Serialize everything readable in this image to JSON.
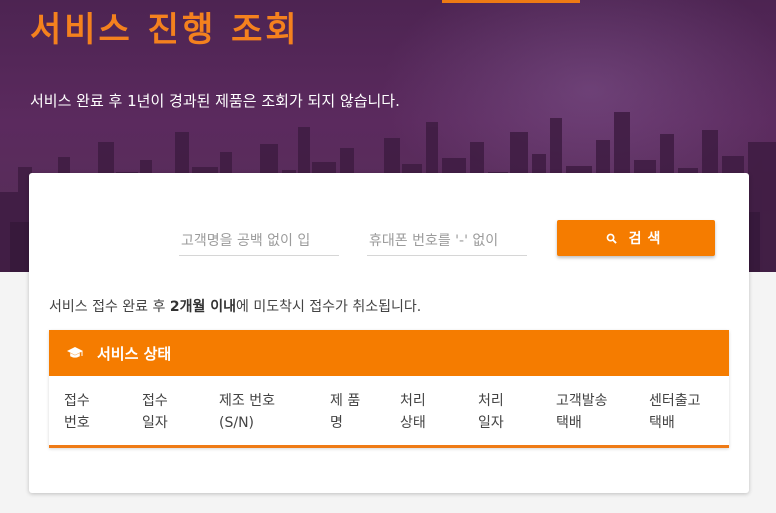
{
  "header": {
    "title": "서비스 진행 조회",
    "subtitle": "서비스 완료 후 1년이 경과된 제품은 조회가 되지 않습니다."
  },
  "search": {
    "name_placeholder": "고객명을 공백 없이 입",
    "name_value": "",
    "phone_placeholder": "휴대폰 번호를 '-' 없이",
    "phone_value": "",
    "button_label": "검색",
    "button_icon": "search-icon"
  },
  "notice": {
    "before": "서비스 접수 완료 후 ",
    "bold": "2개월 이내",
    "after": "에 미도착시 접수가 취소됩니다."
  },
  "status": {
    "title": "서비스 상태",
    "icon": "graduation-cap-icon",
    "columns": [
      {
        "line1": "접수",
        "line2": "번호"
      },
      {
        "line1": "접수",
        "line2": "일자"
      },
      {
        "line1": "제조 번호",
        "line2": "(S/N)"
      },
      {
        "line1": "제 품",
        "line2": "명"
      },
      {
        "line1": "처리",
        "line2": "상태"
      },
      {
        "line1": "처리",
        "line2": "일자"
      },
      {
        "line1": "고객발송",
        "line2": "택배"
      },
      {
        "line1": "센터출고",
        "line2": "택배"
      }
    ],
    "rows": []
  },
  "colors": {
    "accent": "#f57c00",
    "title_orange": "#f4811e",
    "hero_purple": "#5b2a5e",
    "background": "#f4f4f4"
  }
}
